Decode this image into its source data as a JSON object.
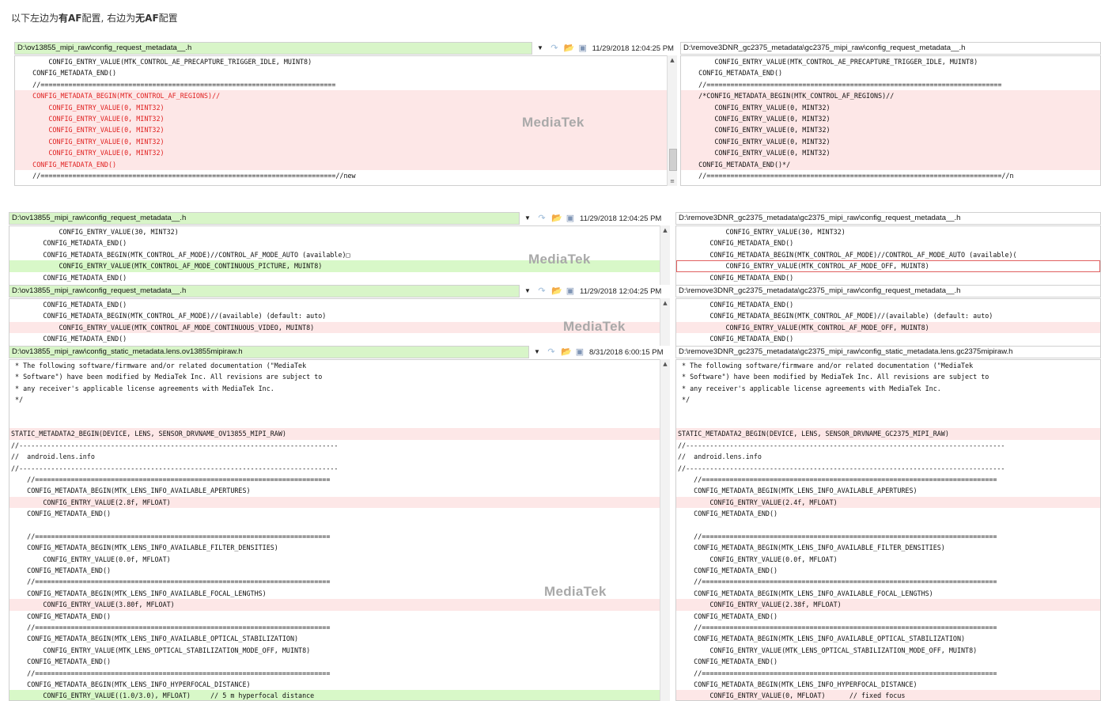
{
  "caption": {
    "p1": "以下左边为",
    "b1": "有AF",
    "p2": "配置, 右边为",
    "b2": "无AF",
    "p3": "配置"
  },
  "watermark": "MediaTek",
  "blocks": {
    "b1": {
      "left_path": "D:\\ov13855_mipi_raw\\config_request_metadata__.h",
      "left_date": "11/29/2018 12:04:25 PM",
      "right_path": "D:\\remove3DNR_gc2375_metadata\\gc2375_mipi_raw\\config_request_metadata__.h",
      "left_lines": [
        "        CONFIG_ENTRY_VALUE(MTK_CONTROL_AE_PRECAPTURE_TRIGGER_IDLE, MUINT8)",
        "    CONFIG_METADATA_END()",
        "    //==========================================================================",
        "    CONFIG_METADATA_BEGIN(MTK_CONTROL_AF_REGIONS)//",
        "        CONFIG_ENTRY_VALUE(0, MINT32)",
        "        CONFIG_ENTRY_VALUE(0, MINT32)",
        "        CONFIG_ENTRY_VALUE(0, MINT32)",
        "        CONFIG_ENTRY_VALUE(0, MINT32)",
        "        CONFIG_ENTRY_VALUE(0, MINT32)",
        "    CONFIG_METADATA_END()",
        "    //==========================================================================//new"
      ],
      "right_lines": [
        "        CONFIG_ENTRY_VALUE(MTK_CONTROL_AE_PRECAPTURE_TRIGGER_IDLE, MUINT8)",
        "    CONFIG_METADATA_END()",
        "    //==========================================================================",
        "    /*CONFIG_METADATA_BEGIN(MTK_CONTROL_AF_REGIONS)//",
        "        CONFIG_ENTRY_VALUE(0, MINT32)",
        "        CONFIG_ENTRY_VALUE(0, MINT32)",
        "        CONFIG_ENTRY_VALUE(0, MINT32)",
        "        CONFIG_ENTRY_VALUE(0, MINT32)",
        "        CONFIG_ENTRY_VALUE(0, MINT32)",
        "    CONFIG_METADATA_END()*/",
        "    //==========================================================================//n"
      ]
    },
    "b2": {
      "left_path": "D:\\ov13855_mipi_raw\\config_request_metadata__.h",
      "left_date": "11/29/2018 12:04:25 PM",
      "right_path": "D:\\remove3DNR_gc2375_metadata\\gc2375_mipi_raw\\config_request_metadata__.h",
      "left_lines": [
        "            CONFIG_ENTRY_VALUE(30, MINT32)",
        "        CONFIG_METADATA_END()",
        "        CONFIG_METADATA_BEGIN(MTK_CONTROL_AF_MODE)//CONTROL_AF_MODE_AUTO (available)□",
        "            CONFIG_ENTRY_VALUE(MTK_CONTROL_AF_MODE_CONTINUOUS_PICTURE, MUINT8)",
        "        CONFIG_METADATA_END()"
      ],
      "right_lines": [
        "            CONFIG_ENTRY_VALUE(30, MINT32)",
        "        CONFIG_METADATA_END()",
        "        CONFIG_METADATA_BEGIN(MTK_CONTROL_AF_MODE)//CONTROL_AF_MODE_AUTO (available)(",
        "            CONFIG_ENTRY_VALUE(MTK_CONTROL_AF_MODE_OFF, MUINT8)",
        "        CONFIG_METADATA_END()"
      ]
    },
    "b3": {
      "left_path": "D:\\ov13855_mipi_raw\\config_request_metadata__.h",
      "left_date": "11/29/2018 12:04:25 PM",
      "right_path": "D:\\remove3DNR_gc2375_metadata\\gc2375_mipi_raw\\config_request_metadata__.h",
      "left_lines": [
        "        CONFIG_METADATA_END()",
        "        CONFIG_METADATA_BEGIN(MTK_CONTROL_AF_MODE)//(available) (default: auto)",
        "            CONFIG_ENTRY_VALUE(MTK_CONTROL_AF_MODE_CONTINUOUS_VIDEO, MUINT8)",
        "        CONFIG_METADATA_END()"
      ],
      "right_lines": [
        "        CONFIG_METADATA_END()",
        "        CONFIG_METADATA_BEGIN(MTK_CONTROL_AF_MODE)//(available) (default: auto)",
        "            CONFIG_ENTRY_VALUE(MTK_CONTROL_AF_MODE_OFF, MUINT8)",
        "        CONFIG_METADATA_END()"
      ]
    },
    "b4": {
      "left_path": "D:\\ov13855_mipi_raw\\config_static_metadata.lens.ov13855mipiraw.h",
      "left_date": "8/31/2018 6:00:15 PM",
      "right_path": "D:\\remove3DNR_gc2375_metadata\\gc2375_mipi_raw\\config_static_metadata.lens.gc2375mipiraw.h",
      "left_lines": [
        " * The following software/firmware and/or related documentation (\"MediaTek",
        " * Software\") have been modified by MediaTek Inc. All revisions are subject to",
        " * any receiver's applicable license agreements with MediaTek Inc.",
        " */",
        "",
        "",
        "STATIC_METADATA2_BEGIN(DEVICE, LENS, SENSOR_DRVNAME_OV13855_MIPI_RAW)",
        "//--------------------------------------------------------------------------------",
        "//  android.lens.info",
        "//--------------------------------------------------------------------------------",
        "    //==========================================================================",
        "    CONFIG_METADATA_BEGIN(MTK_LENS_INFO_AVAILABLE_APERTURES)",
        "        CONFIG_ENTRY_VALUE(2.8f, MFLOAT)",
        "    CONFIG_METADATA_END()",
        "",
        "    //==========================================================================",
        "    CONFIG_METADATA_BEGIN(MTK_LENS_INFO_AVAILABLE_FILTER_DENSITIES)",
        "        CONFIG_ENTRY_VALUE(0.0f, MFLOAT)",
        "    CONFIG_METADATA_END()",
        "    //==========================================================================",
        "    CONFIG_METADATA_BEGIN(MTK_LENS_INFO_AVAILABLE_FOCAL_LENGTHS)",
        "        CONFIG_ENTRY_VALUE(3.80f, MFLOAT)",
        "    CONFIG_METADATA_END()",
        "    //==========================================================================",
        "    CONFIG_METADATA_BEGIN(MTK_LENS_INFO_AVAILABLE_OPTICAL_STABILIZATION)",
        "        CONFIG_ENTRY_VALUE(MTK_LENS_OPTICAL_STABILIZATION_MODE_OFF, MUINT8)",
        "    CONFIG_METADATA_END()",
        "    //==========================================================================",
        "    CONFIG_METADATA_BEGIN(MTK_LENS_INFO_HYPERFOCAL_DISTANCE)",
        "        CONFIG_ENTRY_VALUE((1.0/3.0), MFLOAT)     // 5 m hyperfocal distance"
      ],
      "right_lines": [
        " * The following software/firmware and/or related documentation (\"MediaTek",
        " * Software\") have been modified by MediaTek Inc. All revisions are subject to",
        " * any receiver's applicable license agreements with MediaTek Inc.",
        " */",
        "",
        "",
        "STATIC_METADATA2_BEGIN(DEVICE, LENS, SENSOR_DRVNAME_GC2375_MIPI_RAW)",
        "//--------------------------------------------------------------------------------",
        "//  android.lens.info",
        "//--------------------------------------------------------------------------------",
        "    //==========================================================================",
        "    CONFIG_METADATA_BEGIN(MTK_LENS_INFO_AVAILABLE_APERTURES)",
        "        CONFIG_ENTRY_VALUE(2.4f, MFLOAT)",
        "    CONFIG_METADATA_END()",
        "",
        "    //==========================================================================",
        "    CONFIG_METADATA_BEGIN(MTK_LENS_INFO_AVAILABLE_FILTER_DENSITIES)",
        "        CONFIG_ENTRY_VALUE(0.0f, MFLOAT)",
        "    CONFIG_METADATA_END()",
        "    //==========================================================================",
        "    CONFIG_METADATA_BEGIN(MTK_LENS_INFO_AVAILABLE_FOCAL_LENGTHS)",
        "        CONFIG_ENTRY_VALUE(2.38f, MFLOAT)",
        "    CONFIG_METADATA_END()",
        "    //==========================================================================",
        "    CONFIG_METADATA_BEGIN(MTK_LENS_INFO_AVAILABLE_OPTICAL_STABILIZATION)",
        "        CONFIG_ENTRY_VALUE(MTK_LENS_OPTICAL_STABILIZATION_MODE_OFF, MUINT8)",
        "    CONFIG_METADATA_END()",
        "    //==========================================================================",
        "    CONFIG_METADATA_BEGIN(MTK_LENS_INFO_HYPERFOCAL_DISTANCE)",
        "        CONFIG_ENTRY_VALUE(0, MFLOAT)      // fixed focus"
      ]
    }
  }
}
